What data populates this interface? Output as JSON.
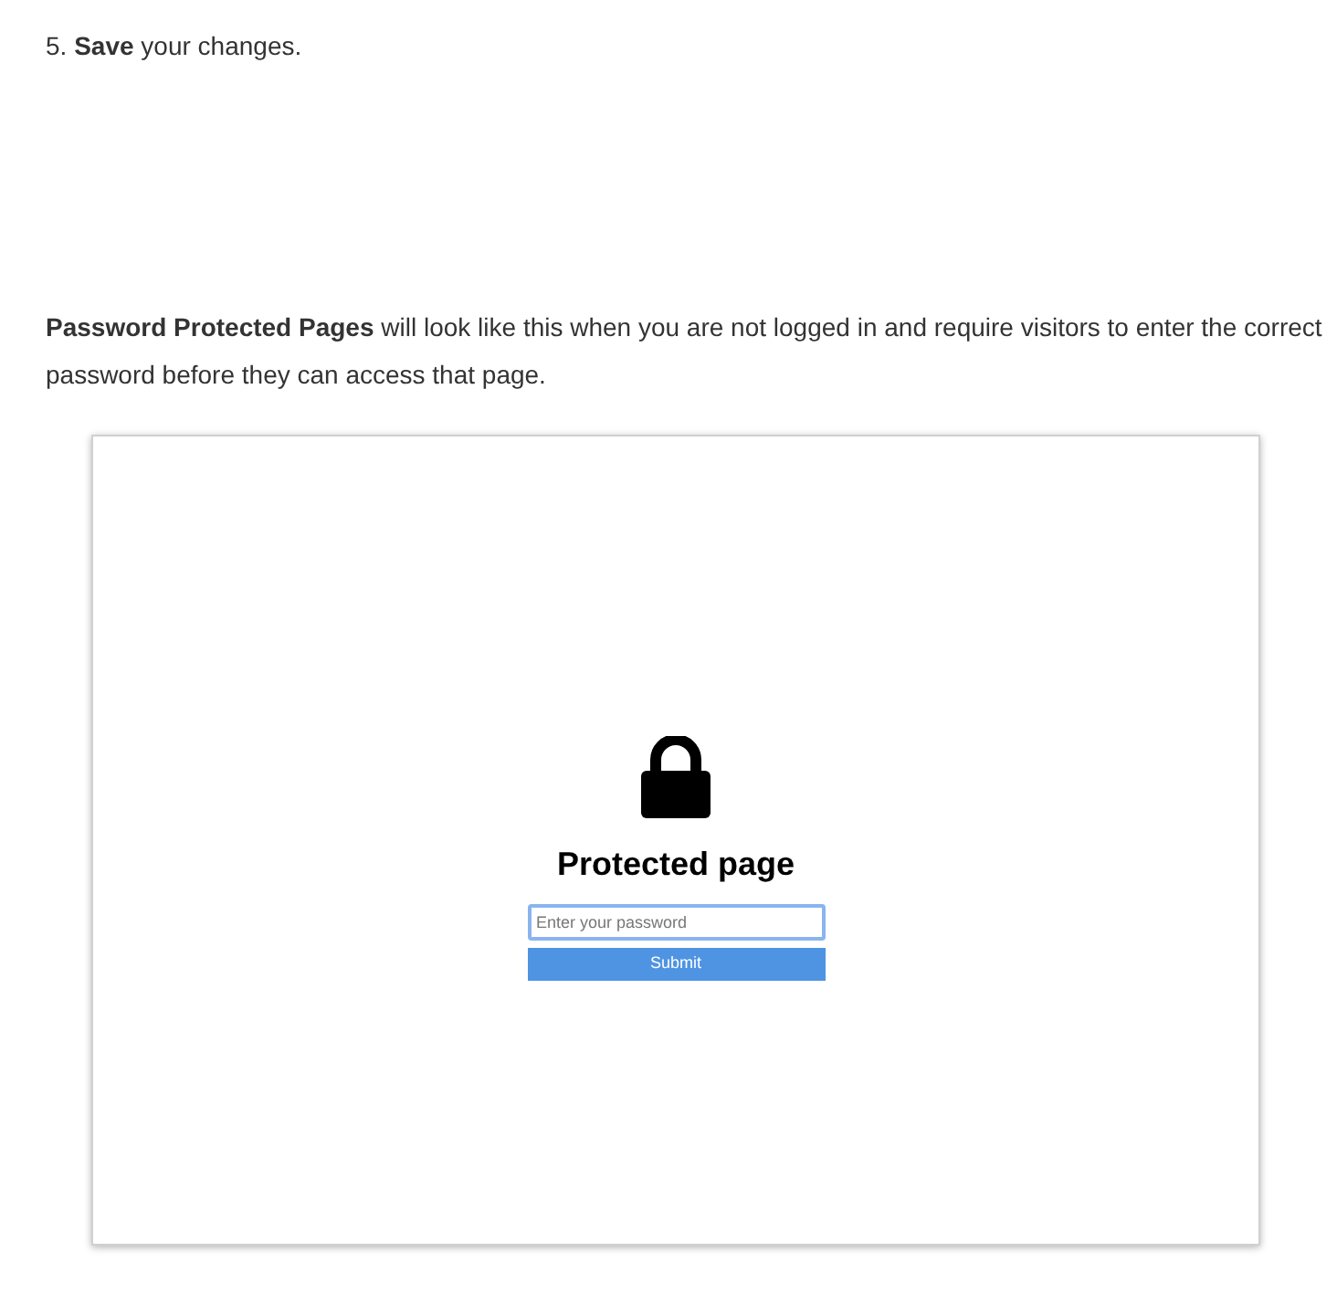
{
  "step": "5. **Save** your changes.",
  "paragraph": "**Password Protected Pages** will look like this when you are not logged in and require visitors to enter the correct password before they can access that page.",
  "preview": {
    "title": "Protected page",
    "password_field": {
      "placeholder": "Enter your password"
    },
    "submit_button": "Submit"
  }
}
